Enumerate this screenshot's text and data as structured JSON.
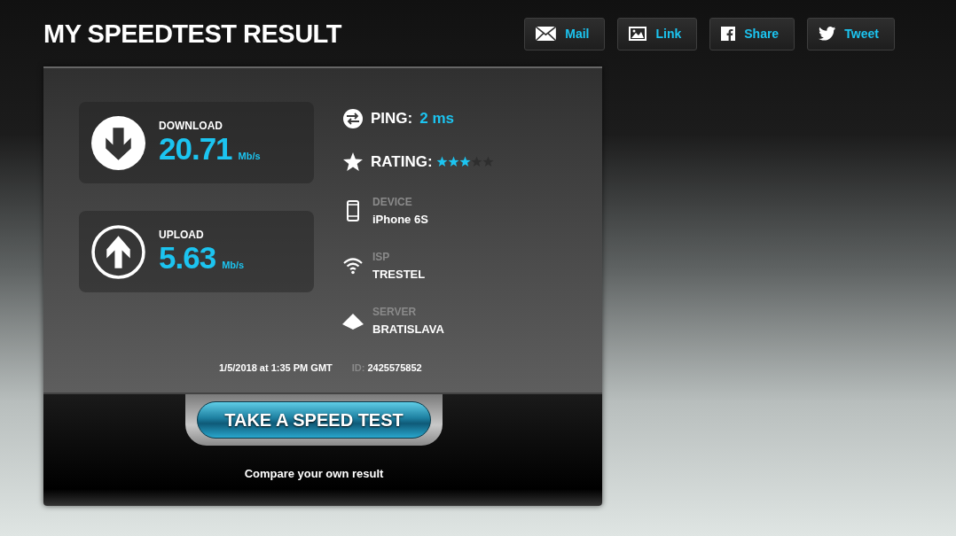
{
  "title": "MY SPEEDTEST RESULT",
  "share_buttons": [
    {
      "kind": "mail",
      "label": "Mail"
    },
    {
      "kind": "link",
      "label": "Link"
    },
    {
      "kind": "facebook",
      "label": "Share"
    },
    {
      "kind": "twitter",
      "label": "Tweet"
    }
  ],
  "speeds": [
    {
      "kind": "download",
      "label": "DOWNLOAD",
      "value": "20.71",
      "unit": "Mb/s"
    },
    {
      "kind": "upload",
      "label": "UPLOAD",
      "value": "5.63",
      "unit": "Mb/s"
    }
  ],
  "ping": {
    "label": "PING:",
    "value": "2 ms"
  },
  "rating": {
    "label": "RATING:",
    "stars": 3
  },
  "details": [
    {
      "kind": "device",
      "label": "DEVICE",
      "value": "iPhone 6S"
    },
    {
      "kind": "isp",
      "label": "ISP",
      "value": "TRESTEL"
    },
    {
      "kind": "server",
      "label": "SERVER",
      "value": "BRATISLAVA"
    }
  ],
  "timestamp": "1/5/2018 at 1:35 PM GMT",
  "id": {
    "label": "ID:",
    "value": "2425575852"
  },
  "cta_button": "TAKE A SPEED TEST",
  "cta_caption": "Compare your own result"
}
